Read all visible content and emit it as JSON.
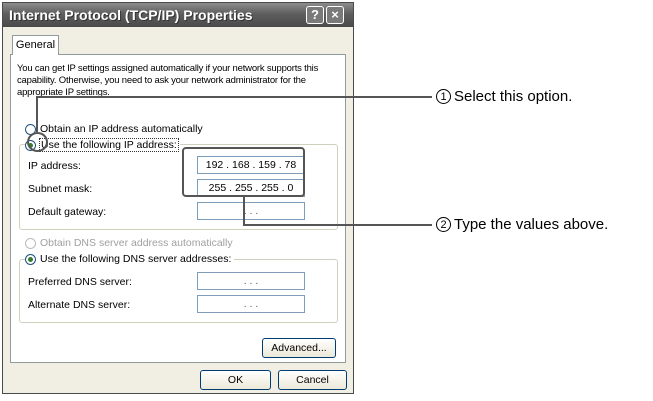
{
  "window": {
    "title": "Internet Protocol (TCP/IP) Properties",
    "help_glyph": "?",
    "close_glyph": "×"
  },
  "tabs": [
    {
      "label": "General",
      "active": true
    }
  ],
  "description": "You can get IP settings assigned automatically if your network supports this capability. Otherwise, you need to ask your network administrator for the appropriate IP settings.",
  "ip_options": {
    "auto": {
      "label": "Obtain an IP address automatically",
      "selected": false
    },
    "manual": {
      "label": "Use the following IP address:",
      "selected": true
    }
  },
  "ip_fields": {
    "ip_address": {
      "label": "IP address:",
      "value": "192 . 168 . 159 .  78"
    },
    "subnet_mask": {
      "label": "Subnet mask:",
      "value": "255 . 255 . 255 .  0"
    },
    "default_gateway": {
      "label": "Default gateway:",
      "value": ".       .       ."
    }
  },
  "dns_options": {
    "auto": {
      "label": "Obtain DNS server address automatically",
      "selected": false,
      "enabled": false
    },
    "manual": {
      "label": "Use the following DNS server addresses:",
      "selected": true
    }
  },
  "dns_fields": {
    "preferred": {
      "label": "Preferred DNS server:",
      "value": ".       .       ."
    },
    "alternate": {
      "label": "Alternate DNS server:",
      "value": ".       .       ."
    }
  },
  "buttons": {
    "advanced": "Advanced...",
    "ok": "OK",
    "cancel": "Cancel"
  },
  "callouts": [
    {
      "number": "1",
      "text": "Select this option."
    },
    {
      "number": "2",
      "text": "Type the values above."
    }
  ],
  "colors": {
    "title_bar": "#5e5e5e",
    "dialog_bg": "#f1efe4",
    "callout_line": "#555555",
    "field_border": "#7f9db9"
  }
}
